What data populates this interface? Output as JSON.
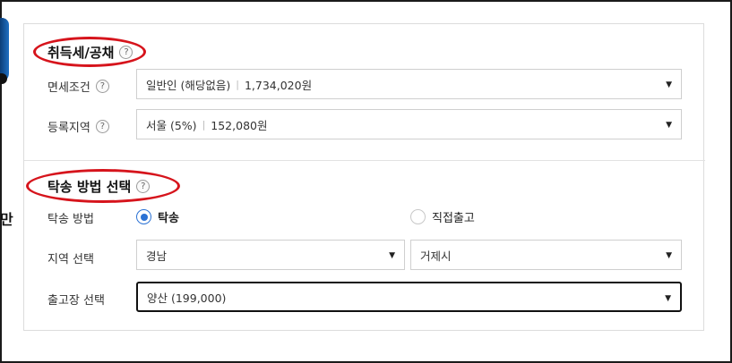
{
  "acquisition": {
    "title": "취득세/공채",
    "help": "?",
    "exemption": {
      "label": "면세조건",
      "help": "?",
      "value": "일반인 (해당없음)",
      "amount": "1,734,020원",
      "caret": "▼"
    },
    "region": {
      "label": "등록지역",
      "help": "?",
      "value": "서울 (5%)",
      "amount": "152,080원",
      "caret": "▼"
    }
  },
  "delivery": {
    "title": "탁송 방법 선택",
    "help": "?",
    "method_label": "탁송 방법",
    "options": [
      {
        "label": "탁송",
        "selected": true
      },
      {
        "label": "직접출고",
        "selected": false
      }
    ],
    "region_label": "지역 선택",
    "province": "경남",
    "city": "거제시",
    "center_label": "출고장 선택",
    "center": "양산 (199,000)",
    "caret": "▼"
  },
  "left_edge_char": "만",
  "colors": {
    "annotation_red": "#d6141c",
    "radio_blue": "#2b72d4",
    "border": "#cfcfcf"
  }
}
